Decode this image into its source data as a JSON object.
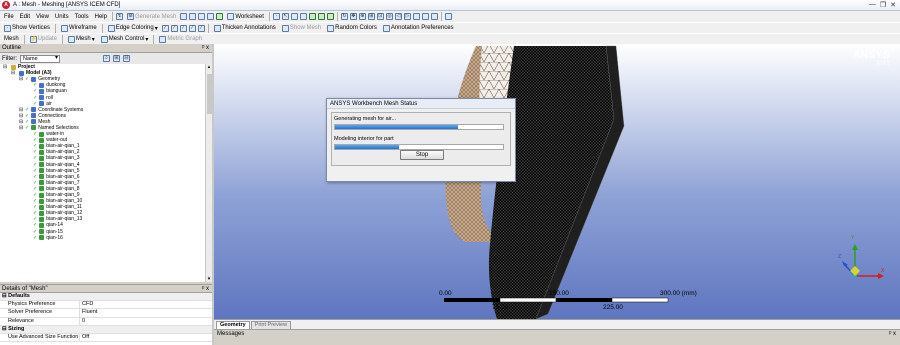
{
  "window": {
    "app_badge": "A",
    "title": "A : Mesh - Meshing [ANSYS ICEM CFD]",
    "controls": [
      "—",
      "❐",
      "✕"
    ]
  },
  "menubar": {
    "items": [
      "File",
      "Edit",
      "View",
      "Units",
      "Tools",
      "Help"
    ],
    "generate_mesh": "Generate Mesh",
    "worksheet": "Worksheet"
  },
  "toolbar2": {
    "show_vertices": "Show Vertices",
    "wireframe": "Wireframe",
    "edge_coloring": "Edge Coloring",
    "thicken_annotations": "Thicken Annotations",
    "show_mesh": "Show Mesh",
    "random_colors": "Random Colors",
    "annotation_preferences": "Annotation Preferences"
  },
  "toolbar3": {
    "mesh": "Mesh",
    "update": "Update",
    "mesh_dropdown": "Mesh",
    "mesh_control": "Mesh Control",
    "metric_graph": "Metric Graph"
  },
  "outline": {
    "title": "Outline",
    "pin": "ᵖ x",
    "filter_label": "Filter:",
    "filter_value": "Name",
    "tree": [
      {
        "label": "Project",
        "depth": 0,
        "icon": "proj",
        "bold": true
      },
      {
        "label": "Model (A3)",
        "depth": 1,
        "icon": "model",
        "bold": true
      },
      {
        "label": "Geometry",
        "depth": 2,
        "icon": "model"
      },
      {
        "label": "duokong",
        "depth": 3,
        "icon": "model"
      },
      {
        "label": "bianguan",
        "depth": 3,
        "icon": "model"
      },
      {
        "label": "roll",
        "depth": 3,
        "icon": "model"
      },
      {
        "label": "air",
        "depth": 3,
        "icon": "model"
      },
      {
        "label": "Coordinate Systems",
        "depth": 2,
        "icon": "model"
      },
      {
        "label": "Connections",
        "depth": 2,
        "icon": "model"
      },
      {
        "label": "Mesh",
        "depth": 2,
        "icon": "model"
      },
      {
        "label": "Named Selections",
        "depth": 2,
        "icon": "ns"
      },
      {
        "label": "water-in",
        "depth": 3,
        "icon": "ns"
      },
      {
        "label": "water-out",
        "depth": 3,
        "icon": "ns"
      },
      {
        "label": "bian-air-qian_1",
        "depth": 3,
        "icon": "ns"
      },
      {
        "label": "bian-air-qian_2",
        "depth": 3,
        "icon": "ns"
      },
      {
        "label": "bian-air-qian_3",
        "depth": 3,
        "icon": "ns"
      },
      {
        "label": "bian-air-qian_4",
        "depth": 3,
        "icon": "ns"
      },
      {
        "label": "bian-air-qian_5",
        "depth": 3,
        "icon": "ns"
      },
      {
        "label": "bian-air-qian_6",
        "depth": 3,
        "icon": "ns"
      },
      {
        "label": "bian-air-qian_7",
        "depth": 3,
        "icon": "ns"
      },
      {
        "label": "bian-air-qian_8",
        "depth": 3,
        "icon": "ns"
      },
      {
        "label": "bian-air-qian_9",
        "depth": 3,
        "icon": "ns"
      },
      {
        "label": "bian-air-qian_10",
        "depth": 3,
        "icon": "ns"
      },
      {
        "label": "bian-air-qian_11",
        "depth": 3,
        "icon": "ns"
      },
      {
        "label": "bian-air-qian_12",
        "depth": 3,
        "icon": "ns"
      },
      {
        "label": "bian-air-qian_13",
        "depth": 3,
        "icon": "ns"
      },
      {
        "label": "qian-14",
        "depth": 3,
        "icon": "ns"
      },
      {
        "label": "qian-15",
        "depth": 3,
        "icon": "ns"
      },
      {
        "label": "qian-16",
        "depth": 3,
        "icon": "ns"
      }
    ]
  },
  "details": {
    "title": "Details of \"Mesh\"",
    "pin": "ᵖ x",
    "rows": [
      {
        "group": true,
        "k": "Defaults",
        "v": ""
      },
      {
        "group": false,
        "k": "Physics Preference",
        "v": "CFD"
      },
      {
        "group": false,
        "k": "Solver Preference",
        "v": "Fluent"
      },
      {
        "group": false,
        "k": "Relevance",
        "v": "0"
      },
      {
        "group": true,
        "k": "Sizing",
        "v": ""
      },
      {
        "group": false,
        "k": "Use Advanced Size Function",
        "v": "Off"
      }
    ]
  },
  "viewport": {
    "logo": "ANSYS",
    "version": "R14.5",
    "scale_labels": {
      "left": "0.00",
      "mid": "150.00",
      "right": "300.00 (mm)",
      "q1": "75.00",
      "q3": "225.00"
    },
    "axes": {
      "y": "Y",
      "x": "X",
      "z": "Z"
    }
  },
  "dialog": {
    "title": "ANSYS Workbench Mesh Status",
    "line1": "Generating mesh for air...",
    "progress1": 0.73,
    "line2": "Modeling interior for part",
    "progress2": 0.38,
    "stop": "Stop"
  },
  "tabs": [
    {
      "label": "Geometry",
      "active": true
    },
    {
      "label": "Print Preview",
      "active": false
    }
  ],
  "messages": {
    "title": "Messages",
    "pin": "ᵖ x"
  }
}
